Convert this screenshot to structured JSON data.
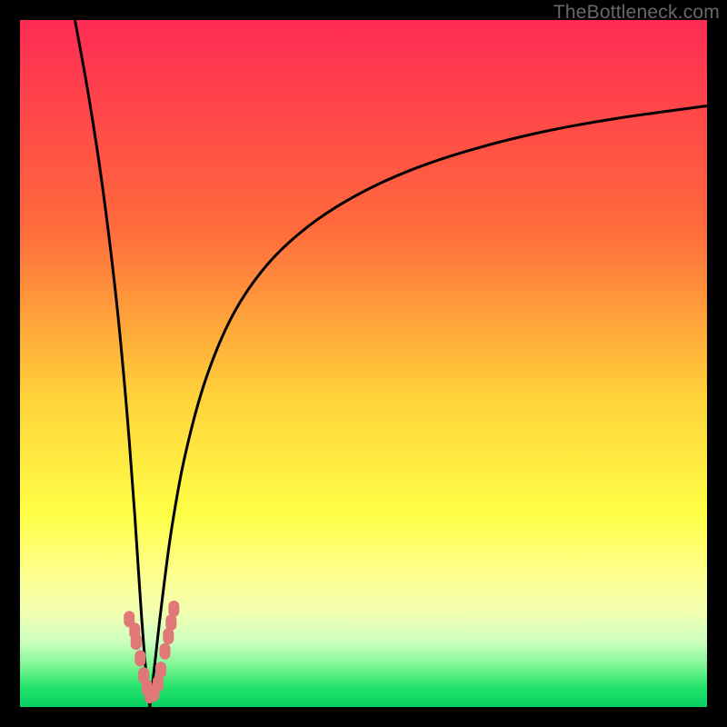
{
  "watermark": "TheBottleneck.com",
  "chart_data": {
    "type": "line",
    "title": "",
    "xlabel": "",
    "ylabel": "",
    "xlim": [
      0,
      100
    ],
    "ylim": [
      0,
      100
    ],
    "gradient_stops": [
      {
        "offset": 0.0,
        "color": "#ff2b54"
      },
      {
        "offset": 0.3,
        "color": "#ff6a3c"
      },
      {
        "offset": 0.55,
        "color": "#ffd23a"
      },
      {
        "offset": 0.72,
        "color": "#ffff47"
      },
      {
        "offset": 0.8,
        "color": "#ffff8a"
      },
      {
        "offset": 0.86,
        "color": "#f4ffb0"
      },
      {
        "offset": 0.905,
        "color": "#ccffc0"
      },
      {
        "offset": 0.94,
        "color": "#7ef693"
      },
      {
        "offset": 0.972,
        "color": "#22e36b"
      },
      {
        "offset": 1.0,
        "color": "#07cf62"
      }
    ],
    "series": [
      {
        "name": "left-branch",
        "x": [
          8.0,
          10.0,
          12.0,
          14.0,
          15.5,
          16.7,
          17.6,
          18.3,
          18.9
        ],
        "values": [
          100,
          88.9,
          75.8,
          59.5,
          43.7,
          28.0,
          14.5,
          5.5,
          0.0
        ]
      },
      {
        "name": "right-branch",
        "x": [
          18.9,
          19.6,
          20.5,
          22.0,
          24.0,
          27.0,
          31.0,
          36.0,
          42.0,
          49.0,
          57.0,
          66.0,
          76.0,
          87.0,
          100.0
        ],
        "values": [
          0.0,
          6.1,
          14.0,
          25.5,
          36.5,
          47.6,
          57.1,
          64.4,
          70.0,
          74.5,
          78.2,
          81.2,
          83.7,
          85.7,
          87.5
        ]
      }
    ],
    "markers": [
      {
        "x": 15.9,
        "y": 12.8
      },
      {
        "x": 16.7,
        "y": 11.1
      },
      {
        "x": 16.9,
        "y": 9.5
      },
      {
        "x": 17.5,
        "y": 7.1
      },
      {
        "x": 18.0,
        "y": 4.6
      },
      {
        "x": 18.5,
        "y": 2.8
      },
      {
        "x": 18.9,
        "y": 1.7
      },
      {
        "x": 19.5,
        "y": 2.0
      },
      {
        "x": 20.1,
        "y": 3.4
      },
      {
        "x": 20.5,
        "y": 5.4
      },
      {
        "x": 21.1,
        "y": 8.1
      },
      {
        "x": 21.6,
        "y": 10.3
      },
      {
        "x": 22.0,
        "y": 12.3
      },
      {
        "x": 22.4,
        "y": 14.3
      }
    ],
    "marker_style": {
      "fill": "#e07878",
      "rx": 6,
      "ry": 9
    }
  }
}
